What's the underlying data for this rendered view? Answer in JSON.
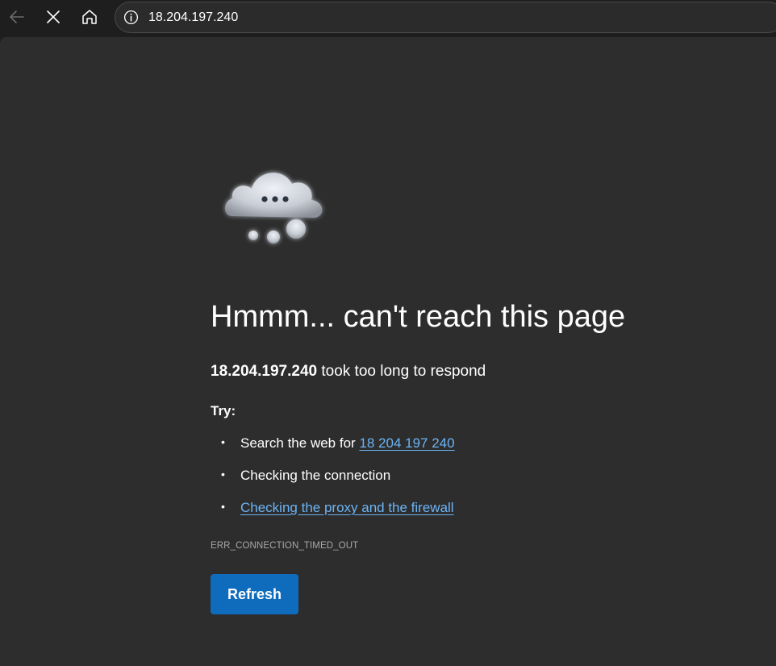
{
  "browser": {
    "url": "18.204.197.240",
    "icons": {
      "back": "back-arrow-icon",
      "stop": "close-icon",
      "home": "home-icon",
      "site_info": "info-icon"
    }
  },
  "error_page": {
    "title": "Hmmm... can't reach this page",
    "host": "18.204.197.240",
    "message": " took too long to respond",
    "try_label": "Try:",
    "suggestions": [
      {
        "prefix": "Search the web for ",
        "link": "18 204 197 240"
      },
      {
        "text": "Checking the connection"
      },
      {
        "link": "Checking the proxy and the firewall"
      }
    ],
    "error_code": "ERR_CONNECTION_TIMED_OUT",
    "refresh_label": "Refresh"
  },
  "colors": {
    "page_background": "#2d2d2d",
    "toolbar_background": "#1e1e1e",
    "link": "#6cb4f5",
    "button": "#0f6cbd"
  }
}
